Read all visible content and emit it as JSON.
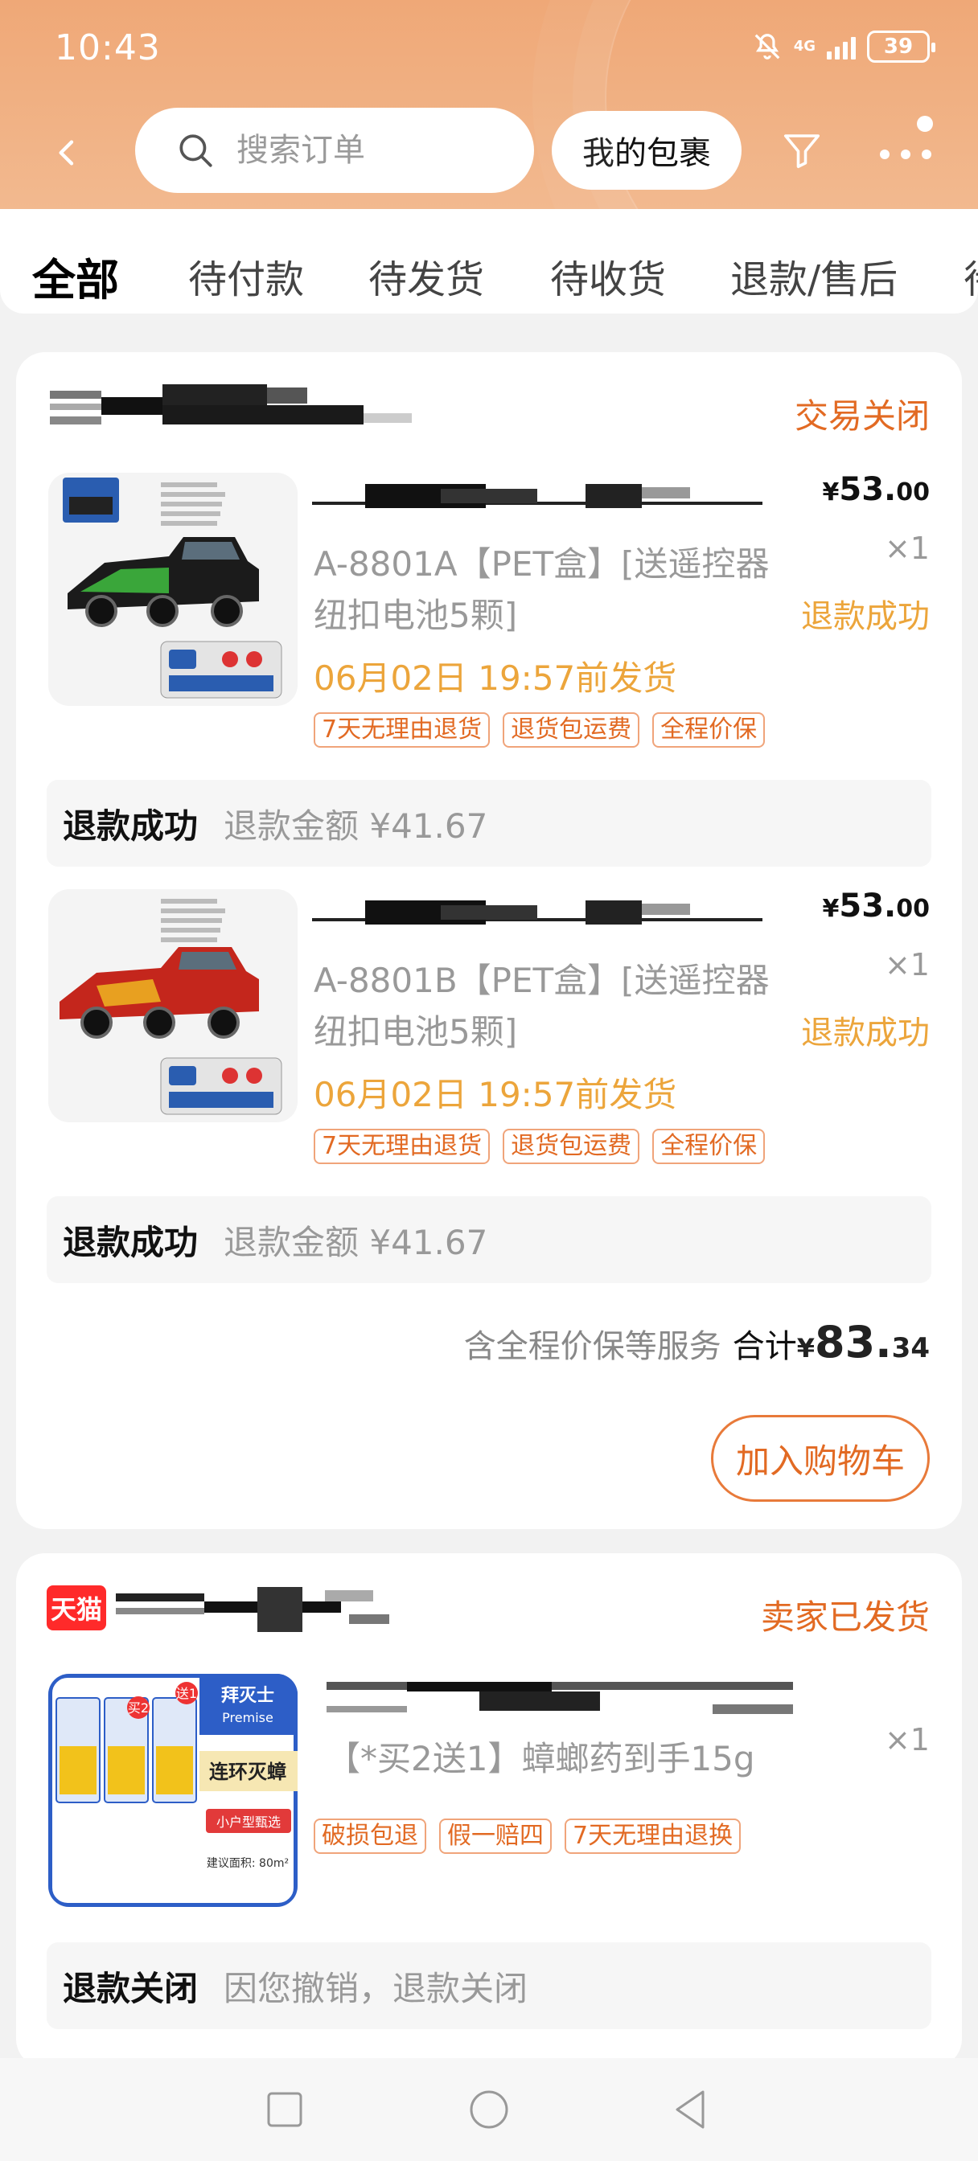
{
  "status_bar": {
    "time": "10:43",
    "battery": "39",
    "network": "4G"
  },
  "header": {
    "search_placeholder": "搜索订单",
    "parcel_button": "我的包裹"
  },
  "tabs": [
    {
      "label": "全部",
      "active": true
    },
    {
      "label": "待付款"
    },
    {
      "label": "待发货"
    },
    {
      "label": "待收货"
    },
    {
      "label": "退款/售后"
    },
    {
      "label": "待"
    }
  ],
  "orders": [
    {
      "status": "交易关闭",
      "items": [
        {
          "title": "A-8801A【PET盒】[送遥控器纽扣电池5颗]",
          "ship_time": "06月02日 19:57前发货",
          "tags": [
            "7天无理由退货",
            "退货包运费",
            "全程价保"
          ],
          "price_yen": "¥",
          "price_int": "53.",
          "price_dec": "00",
          "qty": "×1",
          "item_status": "退款成功",
          "refund_status": "退款成功",
          "refund_text": "退款金额 ¥41.67"
        },
        {
          "title": "A-8801B【PET盒】[送遥控器纽扣电池5颗]",
          "ship_time": "06月02日 19:57前发货",
          "tags": [
            "7天无理由退货",
            "退货包运费",
            "全程价保"
          ],
          "price_yen": "¥",
          "price_int": "53.",
          "price_dec": "00",
          "qty": "×1",
          "item_status": "退款成功",
          "refund_status": "退款成功",
          "refund_text": "退款金额 ¥41.67"
        }
      ],
      "total_note": "含全程价保等服务",
      "total_label": "合计",
      "total_yen": "¥",
      "total_int": "83.",
      "total_dec": "34",
      "action_button": "加入购物车"
    },
    {
      "status": "卖家已发货",
      "store_badge": "天猫",
      "items": [
        {
          "title": "【*买2送1】蟑螂药到手15g",
          "tags": [
            "破损包退",
            "假一赔四",
            "7天无理由退换"
          ],
          "qty": "×1",
          "refund_status": "退款关闭",
          "refund_text": "因您撤销，退款关闭"
        }
      ],
      "thumb_brand": "拜灭士",
      "thumb_brand_en": "Premise",
      "thumb_headline": "连环灭蟑",
      "thumb_sub": "小户型甄选",
      "thumb_badge_2": "买2",
      "thumb_badge_1": "送1",
      "thumb_area": "建议面积: 80m²"
    }
  ],
  "colors": {
    "accent": "#e26a23",
    "ship": "#eca53b",
    "header": "#efa877"
  }
}
